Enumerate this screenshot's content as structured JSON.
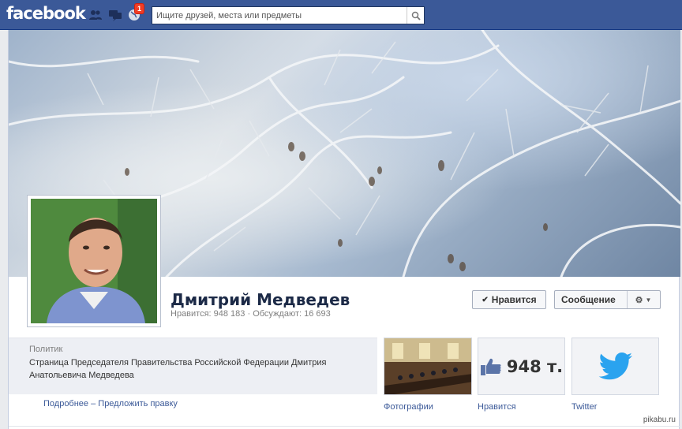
{
  "topbar": {
    "logo": "facebook",
    "notification_count": "1",
    "search_placeholder": "Ищите друзей, места или предметы"
  },
  "profile": {
    "name": "Дмитрий Медведев",
    "stats": "Нравится: 948 183 · Обсуждают: 16 693",
    "like_button": "Нравится",
    "message_button": "Сообщение"
  },
  "about": {
    "category": "Политик",
    "description": "Страница Председателя Правительства Российской Федерации Дмитрия Анатольевича Медведева",
    "more_link": "Подробнее",
    "separator": " – ",
    "suggest_link": "Предложить правку"
  },
  "apps": [
    {
      "label": "Фотографии"
    },
    {
      "label": "Нравится",
      "value": "948 т."
    },
    {
      "label": "Twitter"
    }
  ],
  "watermark": "pikabu.ru",
  "colors": {
    "brand": "#3b5998",
    "badge": "#f03d25",
    "twitter": "#2aa3ef"
  }
}
